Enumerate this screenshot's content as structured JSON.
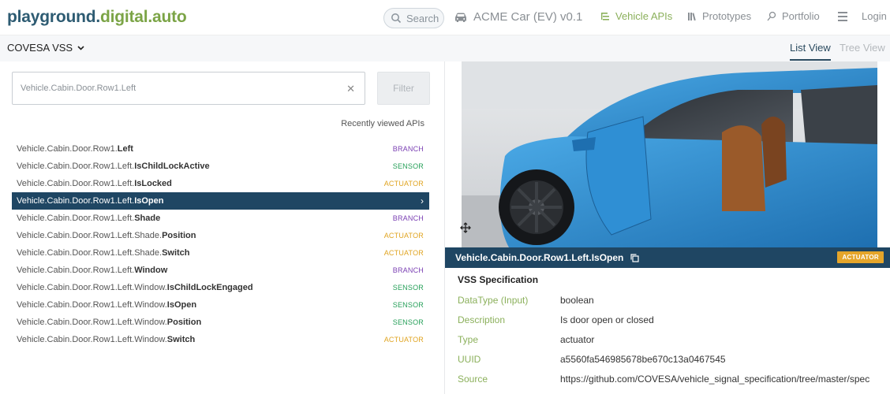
{
  "header": {
    "logo_part1": "playground.",
    "logo_part2": "digital.auto",
    "search_placeholder": "Search",
    "car_model": "ACME Car (EV) v0.1",
    "nav": {
      "vehicle_apis": "Vehicle APIs",
      "prototypes": "Prototypes",
      "portfolio": "Portfolio"
    },
    "login": "Login"
  },
  "subheader": {
    "vss_version": "COVESA VSS",
    "tabs": {
      "list": "List View",
      "tree": "Tree View"
    }
  },
  "filter": {
    "value": "Vehicle.Cabin.Door.Row1.Left",
    "button": "Filter"
  },
  "recently_viewed": "Recently viewed APIs",
  "api_list": [
    {
      "prefix": "Vehicle.Cabin.Door.Row1.",
      "name": "Left",
      "type": "BRANCH"
    },
    {
      "prefix": "Vehicle.Cabin.Door.Row1.Left.",
      "name": "IsChildLockActive",
      "type": "SENSOR"
    },
    {
      "prefix": "Vehicle.Cabin.Door.Row1.Left.",
      "name": "IsLocked",
      "type": "ACTUATOR"
    },
    {
      "prefix": "Vehicle.Cabin.Door.Row1.Left.",
      "name": "IsOpen",
      "type": "",
      "selected": true
    },
    {
      "prefix": "Vehicle.Cabin.Door.Row1.Left.",
      "name": "Shade",
      "type": "BRANCH"
    },
    {
      "prefix": "Vehicle.Cabin.Door.Row1.Left.Shade.",
      "name": "Position",
      "type": "ACTUATOR"
    },
    {
      "prefix": "Vehicle.Cabin.Door.Row1.Left.Shade.",
      "name": "Switch",
      "type": "ACTUATOR"
    },
    {
      "prefix": "Vehicle.Cabin.Door.Row1.Left.",
      "name": "Window",
      "type": "BRANCH"
    },
    {
      "prefix": "Vehicle.Cabin.Door.Row1.Left.Window.",
      "name": "IsChildLockEngaged",
      "type": "SENSOR"
    },
    {
      "prefix": "Vehicle.Cabin.Door.Row1.Left.Window.",
      "name": "IsOpen",
      "type": "SENSOR"
    },
    {
      "prefix": "Vehicle.Cabin.Door.Row1.Left.Window.",
      "name": "Position",
      "type": "SENSOR"
    },
    {
      "prefix": "Vehicle.Cabin.Door.Row1.Left.Window.",
      "name": "Switch",
      "type": "ACTUATOR"
    }
  ],
  "detail": {
    "api_name": "Vehicle.Cabin.Door.Row1.Left.IsOpen",
    "type_badge": "ACTUATOR",
    "spec_title": "VSS Specification",
    "fields": [
      {
        "key": "DataType (Input)",
        "value": "boolean"
      },
      {
        "key": "Description",
        "value": "Is door open or closed"
      },
      {
        "key": "Type",
        "value": "actuator"
      },
      {
        "key": "UUID",
        "value": "a5560fa546985678be670c13a0467545"
      },
      {
        "key": "Source",
        "value": "https://github.com/COVESA/vehicle_signal_specification/tree/master/spec"
      }
    ]
  },
  "colors": {
    "brand_dark": "#2d5b72",
    "brand_green": "#7ba446",
    "selected_bg": "#1f4663",
    "branch": "#7a3fb3",
    "sensor": "#27a05a",
    "actuator": "#e0a421"
  }
}
